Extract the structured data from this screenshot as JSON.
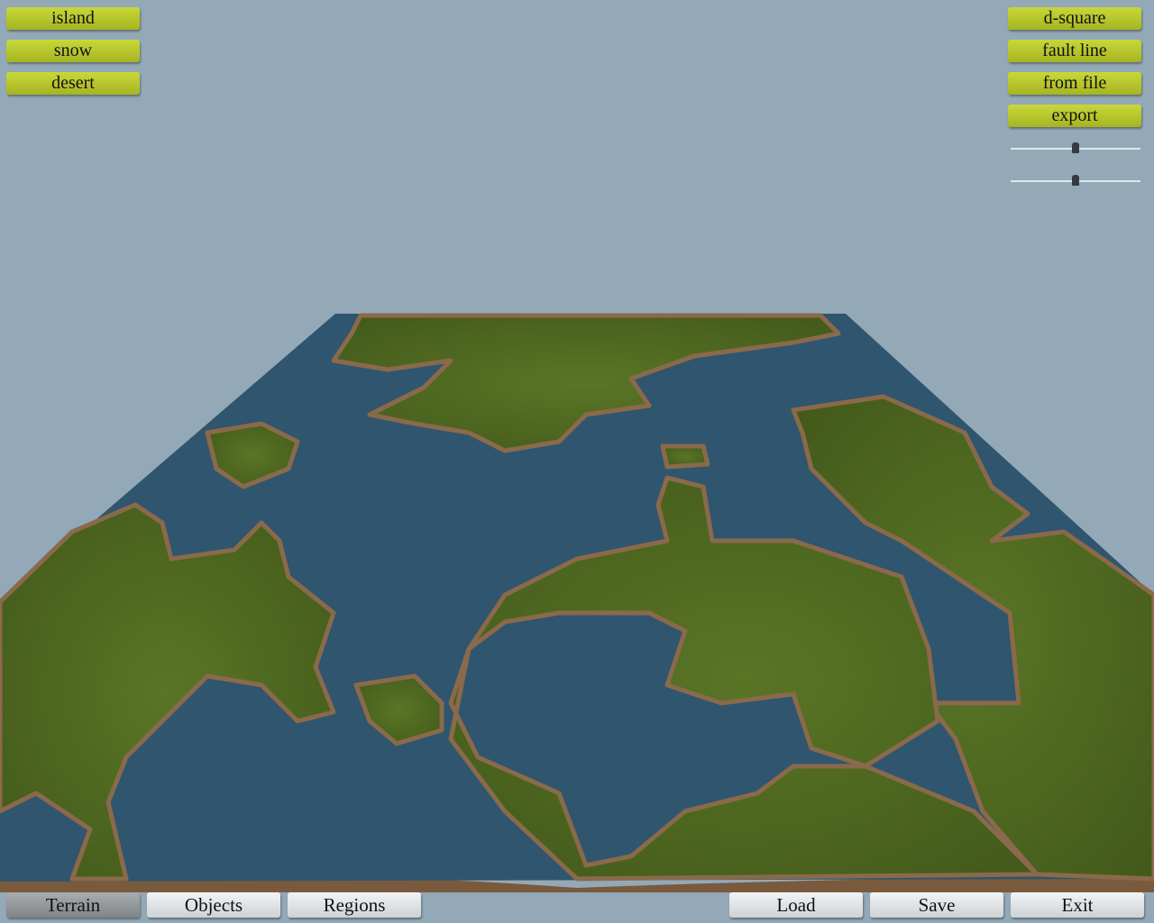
{
  "left_presets": [
    {
      "label": "island"
    },
    {
      "label": "snow"
    },
    {
      "label": "desert"
    }
  ],
  "right_generators": [
    {
      "label": "d-square"
    },
    {
      "label": "fault line"
    },
    {
      "label": "from file"
    },
    {
      "label": "export"
    }
  ],
  "sliders": [
    {
      "value": 0.5
    },
    {
      "value": 0.5
    }
  ],
  "bottom_tabs": [
    {
      "label": "Terrain",
      "active": true
    },
    {
      "label": "Objects"
    },
    {
      "label": "Regions"
    }
  ],
  "bottom_actions": [
    {
      "label": "Load"
    },
    {
      "label": "Save"
    },
    {
      "label": "Exit"
    }
  ],
  "colors": {
    "sky": "#94a9b7",
    "water": "#30556f",
    "land": "#4f6a1f",
    "shore": "#8a6a4a",
    "button_yellow": "#b8c82c"
  }
}
